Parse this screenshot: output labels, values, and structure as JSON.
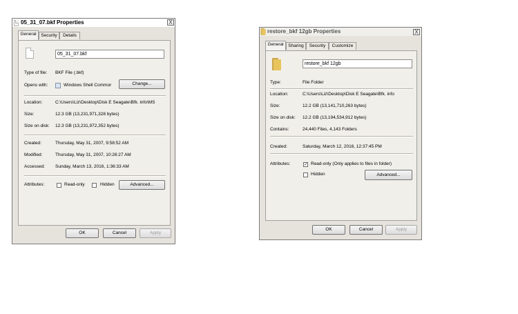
{
  "left": {
    "title": "05_31_07.bkf Properties",
    "close": "X",
    "tabs": [
      "General",
      "Security",
      "Details"
    ],
    "filename": "05_31_07.bkf",
    "type_label": "Type of file:",
    "type_value": "BKF File (.bkf)",
    "opens_label": "Opens with:",
    "opens_value": "Windows Shell Commor",
    "change_button": "Change...",
    "location_label": "Location:",
    "location_value": "C:\\Users\\Liz\\Desktop\\Disk E Seagate\\Bfk. info\\MS",
    "size_label": "Size:",
    "size_value": "12.3 GB (13,231,971,328 bytes)",
    "sizedisk_label": "Size on disk:",
    "sizedisk_value": "12.3 GB (13,231,972,352 bytes)",
    "created_label": "Created:",
    "created_value": "Thursday, May 31, 2007, 9:58:52 AM",
    "modified_label": "Modified:",
    "modified_value": "Thursday, May 31, 2007, 10:26:27 AM",
    "accessed_label": "Accessed:",
    "accessed_value": "Sunday, March 13, 2016, 1:36:33 AM",
    "attributes_label": "Attributes:",
    "readonly_label": "Read-only",
    "readonly_checked": false,
    "hidden_label": "Hidden",
    "hidden_checked": false,
    "advanced_button": "Advanced...",
    "ok_button": "OK",
    "cancel_button": "Cancel",
    "apply_button": "Apply"
  },
  "right": {
    "title": "restore_bkf 12gb Properties",
    "close": "X",
    "tabs": [
      "General",
      "Sharing",
      "Security",
      "Customize"
    ],
    "foldername": "restore_bkf 12gb",
    "type_label": "Type:",
    "type_value": "File Folder",
    "location_label": "Location:",
    "location_value": "C:\\Users\\Liz\\Desktop\\Disk E Seagate\\Bfk. info",
    "size_label": "Size:",
    "size_value": "12.2 GB (13,141,710,263 bytes)",
    "sizedisk_label": "Size on disk:",
    "sizedisk_value": "12.2 GB (13,194,534,912 bytes)",
    "contains_label": "Contains:",
    "contains_value": "24,440 Files, 4,143 Folders",
    "created_label": "Created:",
    "created_value": "Saturday, March 12, 2016, 12:37:45 PM",
    "attributes_label": "Attributes:",
    "readonly_label": "Read-only (Only applies to files in folder)",
    "readonly_checked": true,
    "readonly_mark": "✓",
    "hidden_label": "Hidden",
    "hidden_checked": false,
    "advanced_button": "Advanced...",
    "ok_button": "OK",
    "cancel_button": "Cancel",
    "apply_button": "Apply"
  }
}
